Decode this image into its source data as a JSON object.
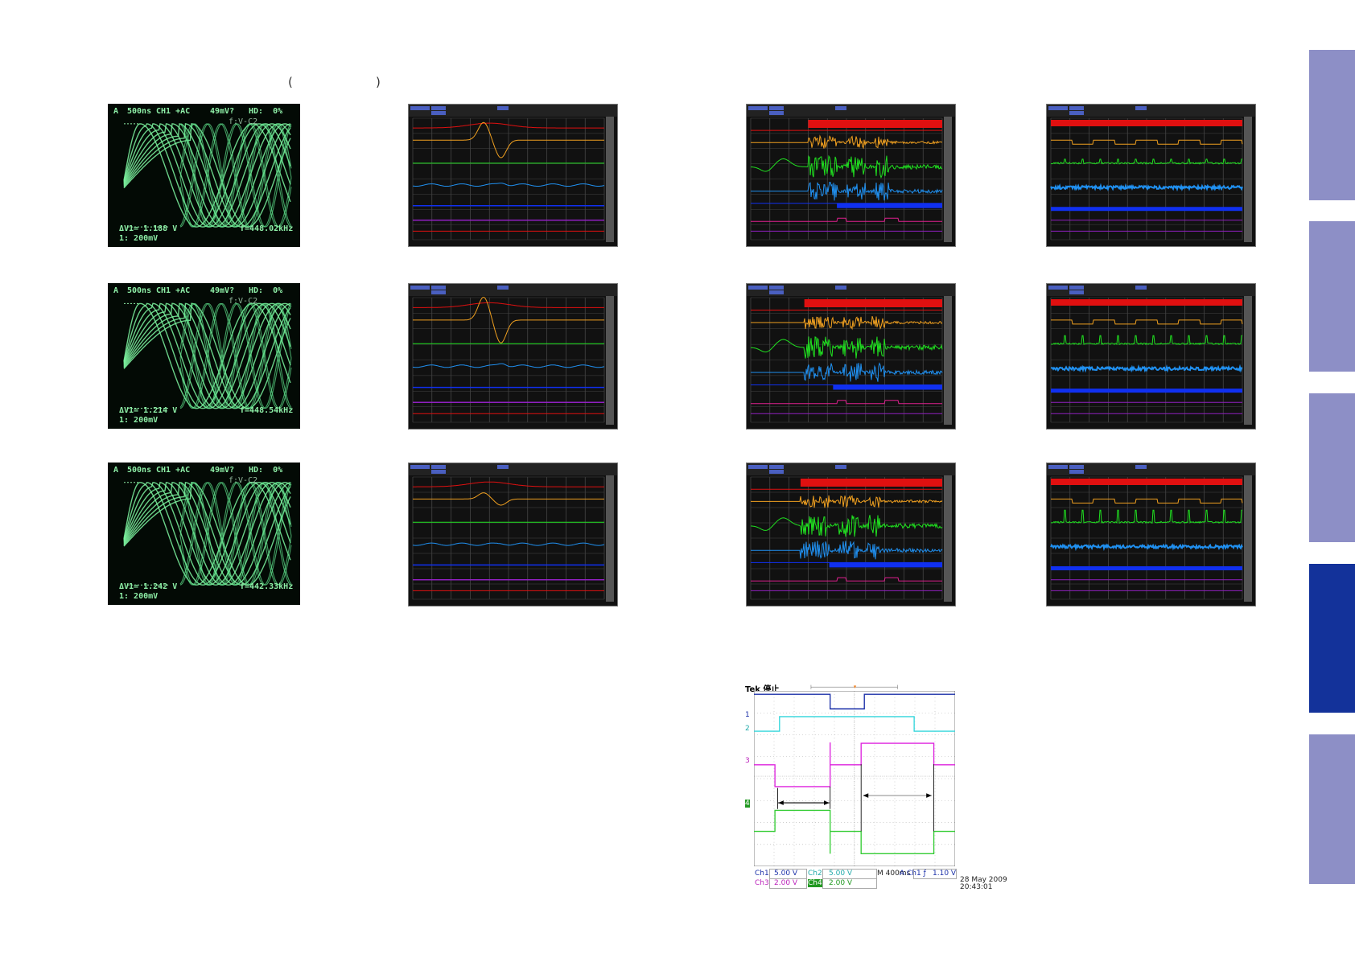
{
  "header": {
    "paren_open": "(",
    "paren_close": ")"
  },
  "analog_scopes": [
    {
      "mode": "A",
      "timebase": "500ns",
      "channel": "CH1 +AC",
      "level": "49mV?",
      "hd": "HD:  0%",
      "cursor": "f:V-C2",
      "dv": "ΔV1= 1.188 V",
      "freq": "f=448.02kHz",
      "scale": "1: 200mV"
    },
    {
      "mode": "A",
      "timebase": "500ns",
      "channel": "CH1 +AC",
      "level": "49mV?",
      "hd": "HD:  0%",
      "cursor": "f:V-C2",
      "dv": "ΔV1= 1.214 V",
      "freq": "f=448.54kHz",
      "scale": "1: 200mV"
    },
    {
      "mode": "A",
      "timebase": "500ns",
      "channel": "CH1 +AC",
      "level": "49mV?",
      "hd": "HD:  0%",
      "cursor": "f:V-C2",
      "dv": "ΔV1= 1.242 V",
      "freq": "f=442.33kHz",
      "scale": "1: 200mV"
    }
  ],
  "recorder_colors": {
    "red": "#e01010",
    "orange": "#f0a020",
    "green": "#20e020",
    "lightblue": "#2090f0",
    "blue": "#1030f0",
    "purple": "#9020c0",
    "magenta": "#e02090"
  },
  "tek": {
    "title": "Tek 停止",
    "ch1": "Ch1",
    "ch1_scale": "5.00 V",
    "ch2": "Ch2",
    "ch2_scale": "5.00 V",
    "ch3": "Ch3",
    "ch3_scale": "2.00 V",
    "ch4": "Ch4",
    "ch4_scale": "2.00 V",
    "timebase": "M 400ms",
    "trigger": "A  Ch1  ƒ",
    "trigger_level": "1.10 V",
    "date": "28 May 2009",
    "time": "20:43:01",
    "markers": [
      "1",
      "2",
      "3",
      "4"
    ],
    "colors": {
      "ch1": "#1a2fa8",
      "ch2": "#33d6dc",
      "ch3": "#dd22dd",
      "ch4": "#33cc33"
    }
  },
  "side_tabs": [
    {
      "active": false
    },
    {
      "active": false
    },
    {
      "active": false
    },
    {
      "active": true
    },
    {
      "active": false
    }
  ]
}
